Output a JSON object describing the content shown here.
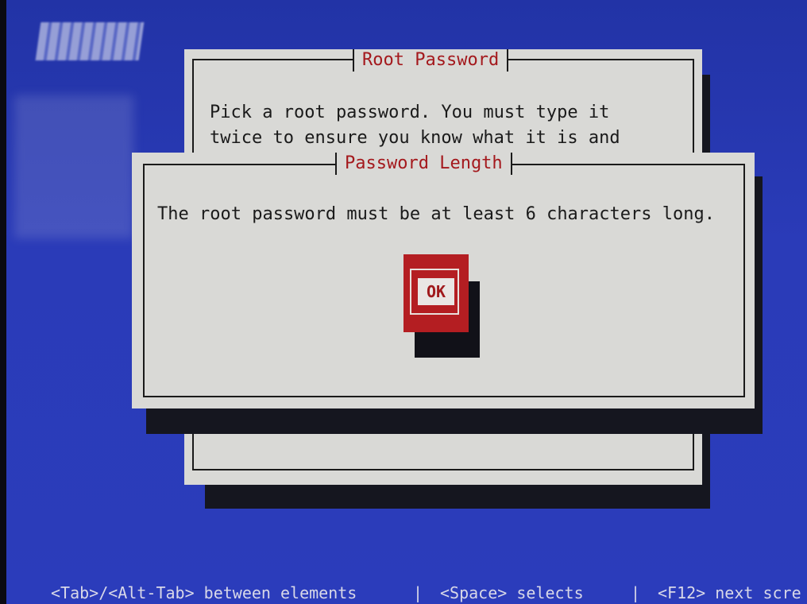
{
  "root_dialog": {
    "title": "Root Password",
    "line1": "Pick a root password. You must type it",
    "line2": "twice to ensure you know what it is and"
  },
  "alert_dialog": {
    "title": "Password Length",
    "message": "The root password must be at least 6 characters long.",
    "ok_label": "OK"
  },
  "status_bar": {
    "part1": "<Tab>/<Alt-Tab> between elements",
    "sep1": "|",
    "part2": "<Space> selects",
    "sep2": "|",
    "part3": "<F12> next scre"
  },
  "colors": {
    "background": "#2a3bb8",
    "dialog": "#d9d9d6",
    "title_text": "#a4191d",
    "button": "#b41e22"
  }
}
